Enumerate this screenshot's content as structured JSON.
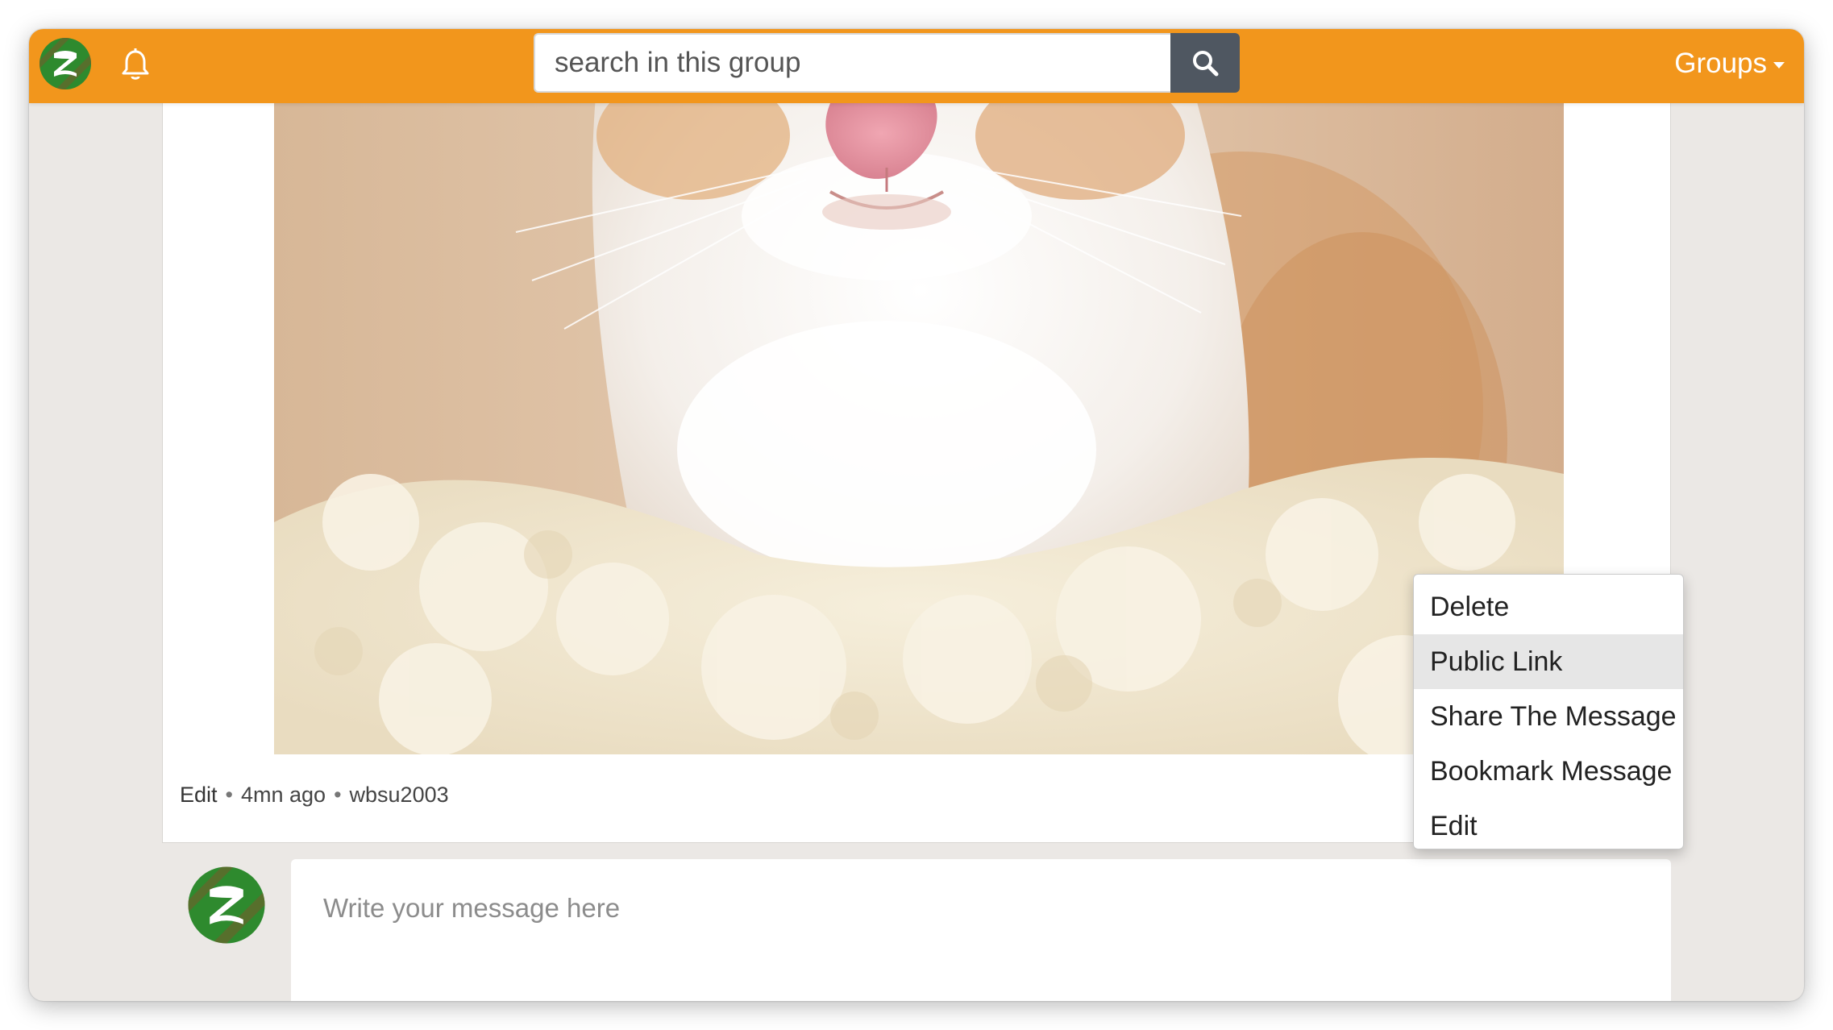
{
  "topbar": {
    "logo_icon": "zulip-logo-icon",
    "notifications_icon": "bell-icon",
    "search": {
      "value": "",
      "placeholder": "search in this group",
      "button_icon": "search-icon"
    },
    "groups_label": "Groups",
    "groups_icon": "caret-down-icon",
    "accent_color": "#f2961c"
  },
  "post": {
    "image_subject": "kitten photo",
    "meta": {
      "edit_label": "Edit",
      "time": "4mn ago",
      "author": "wbsu2003"
    },
    "menu": {
      "items": [
        {
          "label": "Delete",
          "highlighted": false
        },
        {
          "label": "Public Link",
          "highlighted": true
        },
        {
          "label": "Share The Message",
          "highlighted": false
        },
        {
          "label": "Bookmark Message",
          "highlighted": false
        },
        {
          "label": "Edit",
          "highlighted": false
        }
      ]
    }
  },
  "composer": {
    "value": "",
    "placeholder": "Write your message here"
  }
}
